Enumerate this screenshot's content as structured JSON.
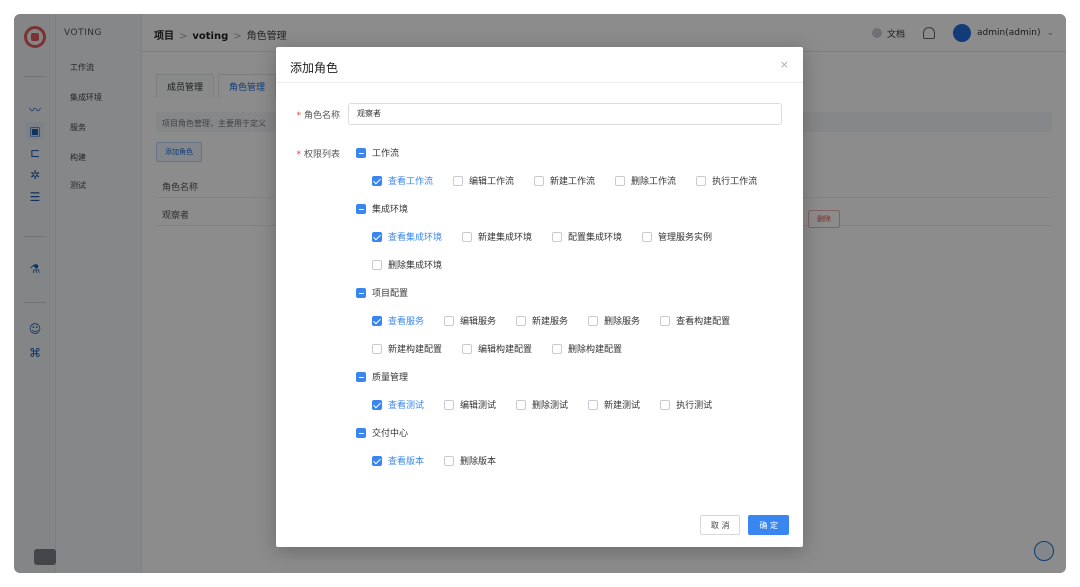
{
  "app": {
    "name": "VOTING"
  },
  "subnav": {
    "items": [
      "工作流",
      "集成环境",
      "服务",
      "构建",
      "测试"
    ]
  },
  "breadcrumb": {
    "root": "项目",
    "project": "voting",
    "current": "角色管理",
    "separator": ">"
  },
  "topbar": {
    "docs": "文档",
    "user": "admin(admin)"
  },
  "page": {
    "tabs": [
      "成员管理",
      "角色管理"
    ],
    "description": "项目角色管理，主要用于定义",
    "add_role_label": "添加角色",
    "table_header": "角色名称",
    "row_name": "观察者",
    "delete_label": "删除"
  },
  "modal": {
    "title": "添加角色",
    "close": "×",
    "name_label": "角色名称",
    "name_value": "观察者",
    "perm_label": "权限列表",
    "groups": [
      {
        "title": "工作流",
        "lines": [
          [
            {
              "label": "查看工作流",
              "checked": true
            },
            {
              "label": "编辑工作流",
              "checked": false
            },
            {
              "label": "新建工作流",
              "checked": false
            },
            {
              "label": "删除工作流",
              "checked": false
            },
            {
              "label": "执行工作流",
              "checked": false
            }
          ]
        ]
      },
      {
        "title": "集成环境",
        "lines": [
          [
            {
              "label": "查看集成环境",
              "checked": true
            },
            {
              "label": "新建集成环境",
              "checked": false
            },
            {
              "label": "配置集成环境",
              "checked": false
            },
            {
              "label": "管理服务实例",
              "checked": false
            }
          ],
          [
            {
              "label": "删除集成环境",
              "checked": false
            }
          ]
        ]
      },
      {
        "title": "项目配置",
        "lines": [
          [
            {
              "label": "查看服务",
              "checked": true
            },
            {
              "label": "编辑服务",
              "checked": false
            },
            {
              "label": "新建服务",
              "checked": false
            },
            {
              "label": "删除服务",
              "checked": false
            },
            {
              "label": "查看构建配置",
              "checked": false
            }
          ],
          [
            {
              "label": "新建构建配置",
              "checked": false
            },
            {
              "label": "编辑构建配置",
              "checked": false
            },
            {
              "label": "删除构建配置",
              "checked": false
            }
          ]
        ]
      },
      {
        "title": "质量管理",
        "lines": [
          [
            {
              "label": "查看测试",
              "checked": true
            },
            {
              "label": "编辑测试",
              "checked": false
            },
            {
              "label": "删除测试",
              "checked": false
            },
            {
              "label": "新建测试",
              "checked": false
            },
            {
              "label": "执行测试",
              "checked": false
            }
          ]
        ]
      },
      {
        "title": "交付中心",
        "lines": [
          [
            {
              "label": "查看版本",
              "checked": true
            },
            {
              "label": "删除版本",
              "checked": false
            }
          ]
        ]
      }
    ],
    "cancel": "取 消",
    "confirm": "确 定"
  },
  "colors": {
    "accent": "#3a86f0",
    "danger": "#e04444"
  }
}
